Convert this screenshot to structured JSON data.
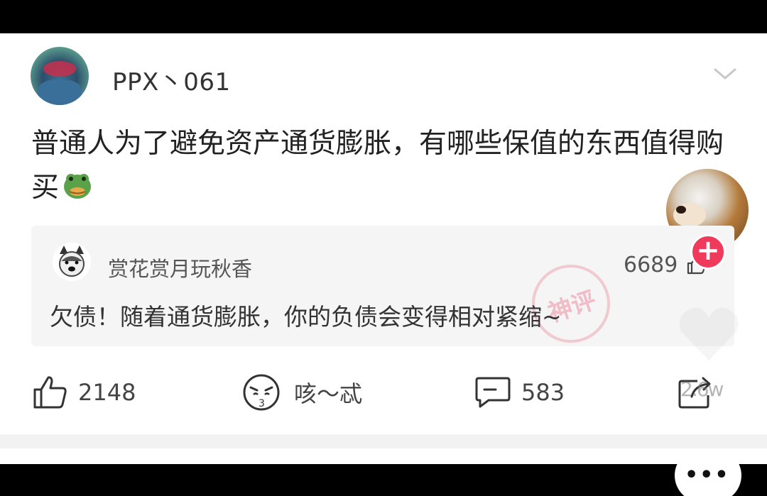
{
  "post": {
    "username": "PPX丶061",
    "title": "普通人为了避免资产通货膨胀，有哪些保值的东西值得购买",
    "title_emoji": "toad-emoji"
  },
  "top_comment": {
    "username": "赏花赏月玩秋香",
    "likes": "6689",
    "text": "欠债！随着通货膨胀，你的负债会变得相对紧缩~",
    "stamp": "神评"
  },
  "actions": {
    "like_count": "2148",
    "emoji_label": "咳～忒",
    "comment_count": "583",
    "share_count": "2.6w"
  },
  "follow": {
    "label": "+"
  },
  "bottom_bubble": {
    "label": "•••"
  },
  "colors": {
    "follow_button": "#f03a5c",
    "comment_bg": "#f5f5f5",
    "text_primary": "#222222",
    "stamp": "#ec788c"
  },
  "icons": {
    "menu": "chevron-down-icon",
    "like": "thumbs-up-icon",
    "emoji": "cough-face-icon",
    "comment": "comment-bubble-icon",
    "share": "share-icon"
  }
}
